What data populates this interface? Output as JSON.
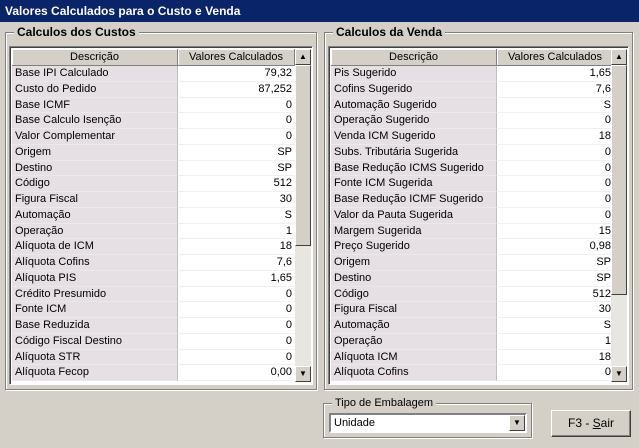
{
  "window": {
    "title": "Valores Calculados para o Custo e Venda"
  },
  "custos": {
    "title": "Calculos dos Custos",
    "col_desc": "Descrição",
    "col_val": "Valores Calculados",
    "rows": [
      {
        "d": "Base IPI Calculado",
        "v": "79,32"
      },
      {
        "d": "Custo do Pedido",
        "v": "87,252"
      },
      {
        "d": "Base ICMF",
        "v": "0"
      },
      {
        "d": "Base Calculo Isenção",
        "v": "0"
      },
      {
        "d": "Valor Complementar",
        "v": "0"
      },
      {
        "d": "Origem",
        "v": "SP"
      },
      {
        "d": "Destino",
        "v": "SP"
      },
      {
        "d": "Código",
        "v": "512"
      },
      {
        "d": "Figura Fiscal",
        "v": "30"
      },
      {
        "d": "Automação",
        "v": "S"
      },
      {
        "d": "Operação",
        "v": "1"
      },
      {
        "d": "Alíquota de ICM",
        "v": "18"
      },
      {
        "d": "Alíquota Cofins",
        "v": "7,6"
      },
      {
        "d": "Alíquota PIS",
        "v": "1,65"
      },
      {
        "d": "Crédito Presumido",
        "v": "0"
      },
      {
        "d": "Fonte ICM",
        "v": "0"
      },
      {
        "d": "Base Reduzida",
        "v": "0"
      },
      {
        "d": "Código Fiscal Destino",
        "v": "0"
      },
      {
        "d": "Alíquota STR",
        "v": "0"
      },
      {
        "d": "Alíquota Fecop",
        "v": "0,00"
      }
    ]
  },
  "venda": {
    "title": "Calculos da Venda",
    "col_desc": "Descrição",
    "col_val": "Valores Calculados",
    "rows": [
      {
        "d": "Pis Sugerido",
        "v": "1,65"
      },
      {
        "d": "Cofins Sugerido",
        "v": "7,6"
      },
      {
        "d": "Automação Sugerido",
        "v": "S"
      },
      {
        "d": "Operação Sugerido",
        "v": "0"
      },
      {
        "d": "Venda ICM Sugerido",
        "v": "18"
      },
      {
        "d": "Subs. Tributária Sugerida",
        "v": "0"
      },
      {
        "d": "Base Redução ICMS Sugerido",
        "v": "0"
      },
      {
        "d": "Fonte ICM Sugerida",
        "v": "0"
      },
      {
        "d": "Base Redução ICMF Sugerido",
        "v": "0"
      },
      {
        "d": "Valor da Pauta Sugerida",
        "v": "0"
      },
      {
        "d": "Margem Sugerida",
        "v": "15"
      },
      {
        "d": "Preço Sugerido",
        "v": "0,98"
      },
      {
        "d": "Origem",
        "v": "SP"
      },
      {
        "d": "Destino",
        "v": "SP"
      },
      {
        "d": "Código",
        "v": "512"
      },
      {
        "d": "Figura Fiscal",
        "v": "30"
      },
      {
        "d": "Automação",
        "v": "S"
      },
      {
        "d": "Operação",
        "v": "1"
      },
      {
        "d": "Alíquota ICM",
        "v": "18"
      },
      {
        "d": "Alíquota Cofins",
        "v": "0"
      }
    ]
  },
  "embalagem": {
    "label": "Tipo de Embalagem",
    "value": "Unidade"
  },
  "exit_button": {
    "prefix": "F3 - ",
    "accel": "S",
    "rest": "air"
  }
}
